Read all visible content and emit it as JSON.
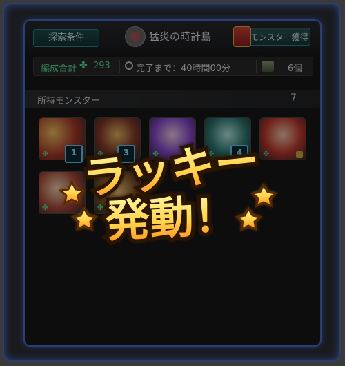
{
  "header": {
    "search_button_label": "探索条件",
    "title": "猛炎の時計島",
    "get_monsters_button_label": "モンスター獲得"
  },
  "stats": {
    "formation_total_label": "編成合計",
    "formation_total_value": "293",
    "time_label": "完了まで：40時間00分",
    "item_count": "6個"
  },
  "owned_monsters": {
    "title": "所持モンスター",
    "count": "7",
    "cards": [
      {
        "badge": ""
      },
      {
        "badge": ""
      },
      {
        "badge": ""
      },
      {
        "badge": "4"
      },
      {
        "badge": ""
      },
      {
        "badge": ""
      },
      {
        "badge": ""
      }
    ],
    "visible_badges": [
      "1",
      "3",
      "4"
    ]
  },
  "overlay": {
    "line1": "ラッキー",
    "line2": "発動！"
  },
  "colors": {
    "accent_teal": "#2f8d93",
    "stat_green": "#5fe59b",
    "frame_blue": "#2b4ca6",
    "lucky_yellow": "#ffe14a",
    "lucky_orange": "#ff8a1b"
  }
}
